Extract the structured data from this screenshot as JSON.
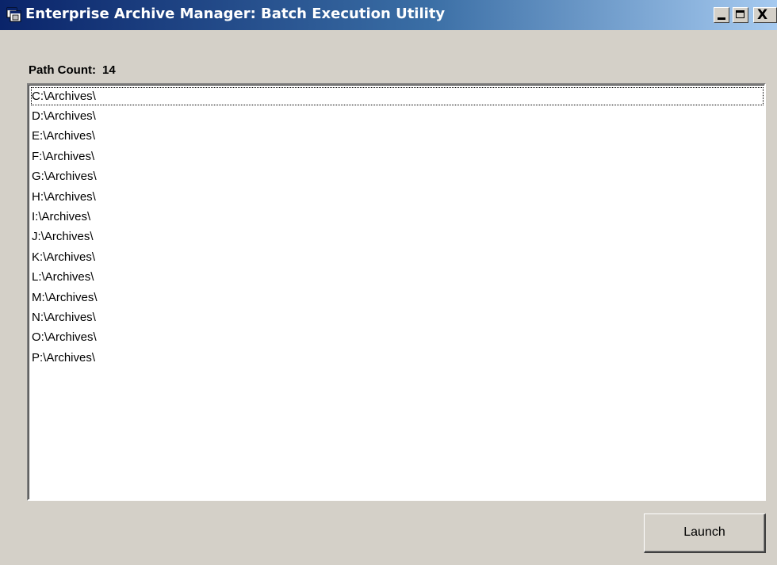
{
  "window": {
    "title": "Enterprise Archive Manager: Batch Execution Utility",
    "controls": {
      "minimize_icon": "minimize-icon",
      "maximize_icon": "maximize-icon",
      "close_glyph": "X"
    }
  },
  "path_count": {
    "label": "Path Count:",
    "value": "14"
  },
  "paths": [
    "C:\\Archives\\",
    "D:\\Archives\\",
    "E:\\Archives\\",
    "F:\\Archives\\",
    "G:\\Archives\\",
    "H:\\Archives\\",
    "I:\\Archives\\",
    "J:\\Archives\\",
    "K:\\Archives\\",
    "L:\\Archives\\",
    "M:\\Archives\\",
    "N:\\Archives\\",
    "O:\\Archives\\",
    "P:\\Archives\\"
  ],
  "launch_button": {
    "label": "Launch"
  },
  "colors": {
    "titlebar_start": "#0a246a",
    "titlebar_end": "#a6caf0",
    "face": "#d4d0c8"
  }
}
